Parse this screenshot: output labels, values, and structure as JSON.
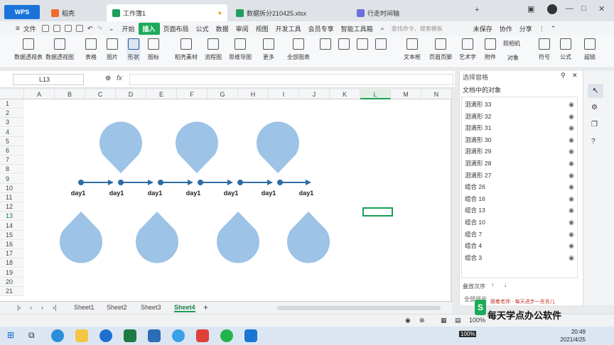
{
  "tabs": {
    "wps": "WPS",
    "items": [
      {
        "label": "稻壳"
      },
      {
        "label": "工作簿1"
      },
      {
        "label": "数据拆分210425.xlsx"
      },
      {
        "label": "行走时间轴"
      }
    ]
  },
  "menu": {
    "file": "文件",
    "items": [
      "开始",
      "插入",
      "页面布局",
      "公式",
      "数据",
      "审阅",
      "视图",
      "开发工具",
      "会员专享",
      "智能工具箱"
    ],
    "active": "插入",
    "search_placeholder": "查找命令、搜索模板",
    "unsaved": "未保存",
    "collab": "协作",
    "share": "分享"
  },
  "ribbon": {
    "items": [
      "数据透视表",
      "数据透视图",
      "表格",
      "图片",
      "形状",
      "图标",
      "稻壳素材",
      "流程图",
      "思维导图",
      "更多",
      "全部图表",
      "文本框",
      "页眉页脚",
      "艺术字",
      "附件",
      "照相机",
      "对象",
      "符号",
      "公式",
      "超链"
    ]
  },
  "formula_bar": {
    "cell_ref": "L13",
    "fx": "fx"
  },
  "grid": {
    "columns": [
      "A",
      "B",
      "C",
      "D",
      "E",
      "F",
      "G",
      "H",
      "I",
      "J",
      "K",
      "L",
      "M",
      "N"
    ],
    "rows": [
      "1",
      "2",
      "3",
      "4",
      "5",
      "6",
      "7",
      "8",
      "9",
      "10",
      "11",
      "12",
      "13",
      "14",
      "15",
      "16",
      "17",
      "18",
      "19",
      "20",
      "21"
    ],
    "selected_column": "L",
    "selected_row": "13"
  },
  "timeline": {
    "labels": [
      "day1",
      "day1",
      "day1",
      "day1",
      "day1",
      "day1",
      "day1"
    ],
    "drop_color": "#9dc3e6",
    "line_color": "#2e6da4"
  },
  "sheets": {
    "items": [
      "Sheet1",
      "Sheet2",
      "Sheet3",
      "Sheet4"
    ],
    "active": "Sheet4"
  },
  "pane": {
    "title": "选择窗格",
    "subtitle": "文档中的对象",
    "objects": [
      "泪滴形 33",
      "泪滴形 32",
      "泪滴形 31",
      "泪滴形 30",
      "泪滴形 29",
      "泪滴形 28",
      "泪滴形 27",
      "组合 26",
      "组合 16",
      "组合 13",
      "组合 10",
      "组合 7",
      "组合 4",
      "组合 3"
    ],
    "order_label": "叠放次序",
    "show_all": "全部显示"
  },
  "status": {
    "zoom": "100%"
  },
  "taskbar": {
    "time": "20:49",
    "date": "2021/4/25",
    "battery": "100%"
  },
  "watermark": {
    "top": "跟着老师 · 每天进步一丢丢儿",
    "main": "每天学点办公软件"
  }
}
